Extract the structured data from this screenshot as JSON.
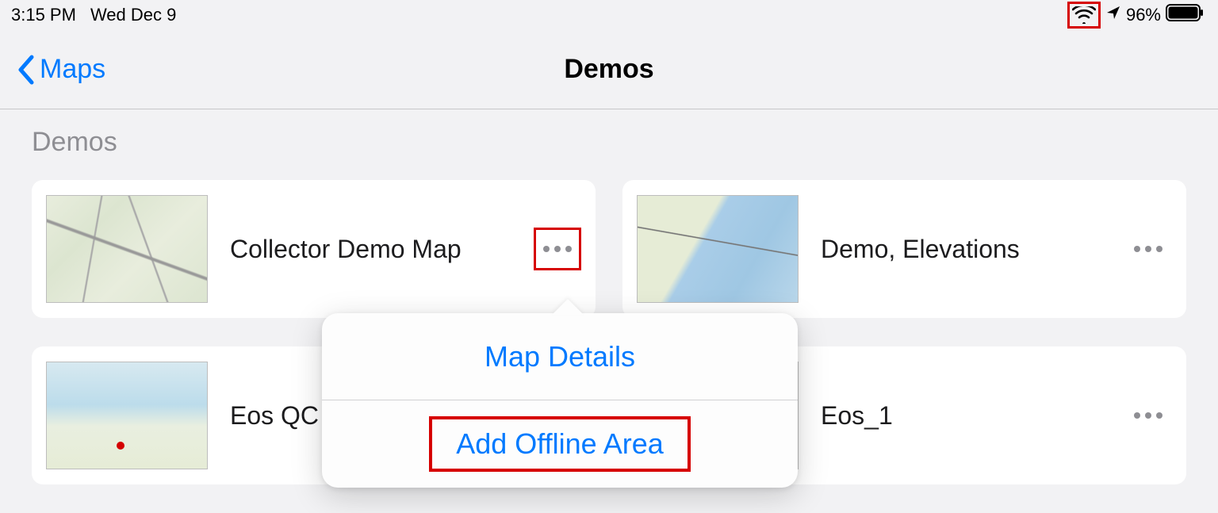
{
  "status": {
    "time": "3:15 PM",
    "date": "Wed Dec 9",
    "battery": "96%"
  },
  "nav": {
    "back_label": "Maps",
    "title": "Demos"
  },
  "section_header": "Demos",
  "cards": [
    {
      "title": "Collector Demo Map"
    },
    {
      "title": "Demo, Elevations"
    },
    {
      "title": "Eos QC"
    },
    {
      "title": "Eos_1"
    }
  ],
  "popover": {
    "items": [
      {
        "label": "Map Details"
      },
      {
        "label": "Add Offline Area"
      }
    ]
  }
}
